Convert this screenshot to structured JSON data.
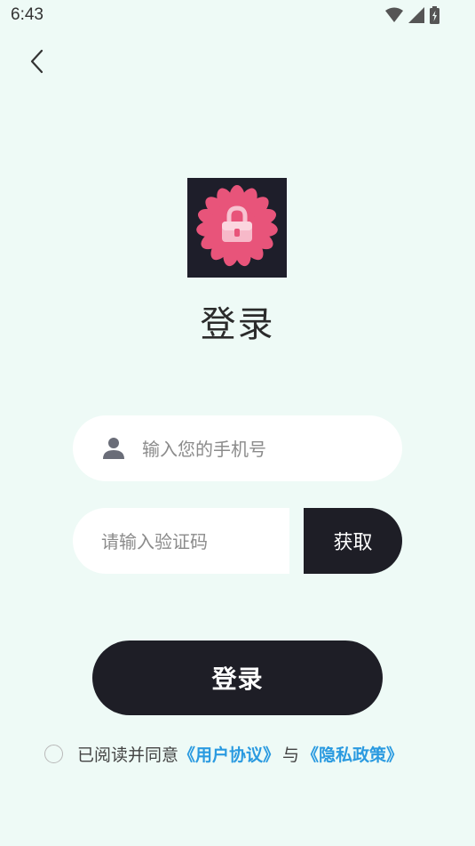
{
  "status_bar": {
    "time": "6:43",
    "icons": [
      "wifi-icon",
      "signal-icon",
      "battery-charging-icon"
    ]
  },
  "header": {
    "back_icon": "chevron-left-icon"
  },
  "logo": {
    "icon": "flower-lock-logo",
    "colors": {
      "background": "#1e1e2a",
      "petals": "#e8547a",
      "lock": "#f7b9c9"
    }
  },
  "title": "登录",
  "form": {
    "phone": {
      "icon": "user-icon",
      "placeholder": "输入您的手机号",
      "value": ""
    },
    "code": {
      "placeholder": "请输入验证码",
      "value": ""
    },
    "get_code_label": "获取"
  },
  "login_label": "登录",
  "agreement": {
    "checked": false,
    "text": "已阅读并同意",
    "user_agreement": "《用户协议》",
    "conjunction": "与",
    "privacy_policy": "《隐私政策》"
  },
  "colors": {
    "background": "#eefaf6",
    "button": "#1e1e26",
    "link": "#2a9ae0"
  }
}
